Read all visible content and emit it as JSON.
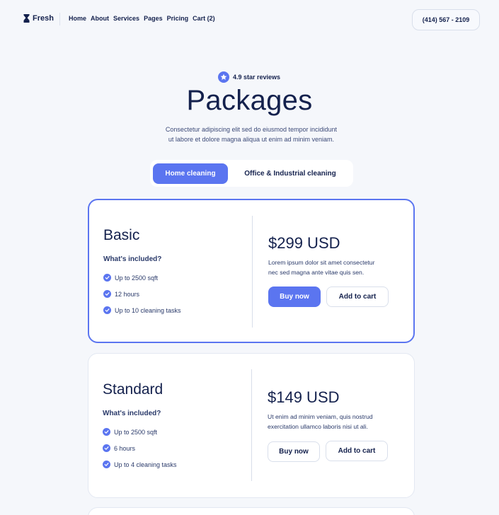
{
  "header": {
    "logo_text": "Fresh",
    "nav": [
      "Home",
      "About",
      "Services",
      "Pages",
      "Pricing",
      "Cart (2)"
    ],
    "phone": "(414) 567 - 2109"
  },
  "hero": {
    "rating": "4.9 star reviews",
    "title": "Packages",
    "subtitle_line1": "Consectetur adipiscing elit sed do eiusmod tempor incididunt",
    "subtitle_line2": "ut labore et dolore magna aliqua ut enim ad minim veniam."
  },
  "tabs": [
    {
      "label": "Home cleaning",
      "active": true
    },
    {
      "label": "Office & Industrial cleaning",
      "active": false
    }
  ],
  "plans": [
    {
      "name": "Basic",
      "included_label": "What's included?",
      "features": [
        "Up to 2500 sqft",
        "12 hours",
        "Up to 10 cleaning tasks"
      ],
      "price": "$299 USD",
      "desc_line1": "Lorem ipsum dolor sit amet consectetur",
      "desc_line2": "nec sed magna ante vitae quis sen.",
      "buy_label": "Buy now",
      "cart_label": "Add to cart"
    },
    {
      "name": "Standard",
      "included_label": "What's included?",
      "features": [
        "Up to 2500 sqft",
        "6 hours",
        "Up to 4 cleaning tasks"
      ],
      "price": "$149 USD",
      "desc_line1": "Ut enim ad minim veniam, quis nostrud",
      "desc_line2": "exercitation ullamco laboris nisi ut ali.",
      "buy_label": "Buy now",
      "cart_label": "Add to cart"
    }
  ],
  "colors": {
    "accent": "#5b75f0",
    "text": "#14214d",
    "background": "#f5f7fb"
  }
}
